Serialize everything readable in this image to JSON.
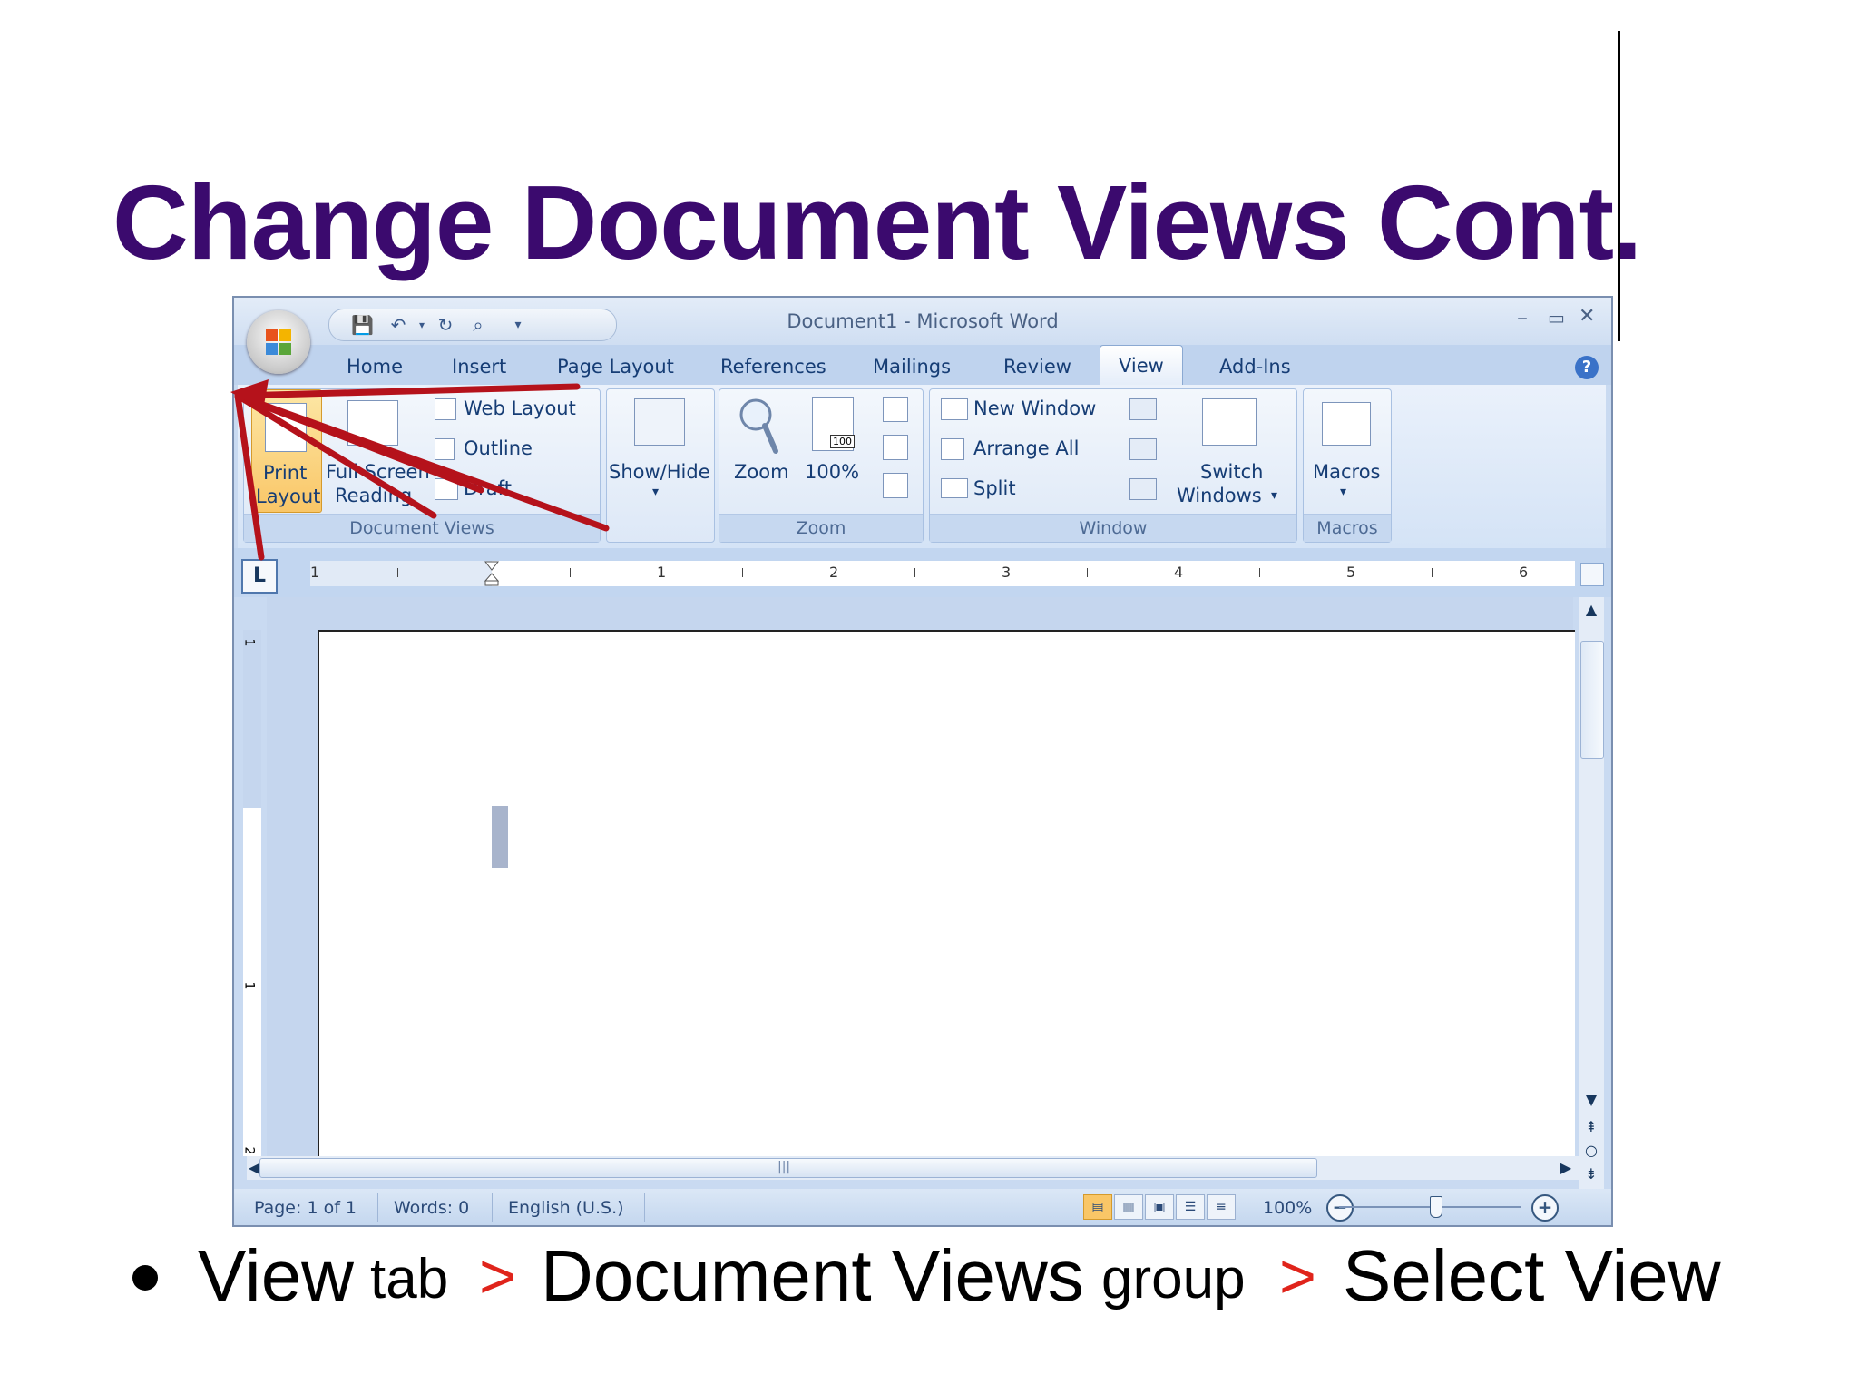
{
  "slide": {
    "title": "Change Document Views Cont.",
    "bullet": {
      "view": "View",
      "tab_word": "tab",
      "sep1": ">",
      "document_views": "Document Views",
      "group_word": "group",
      "sep2": ">",
      "select_view": "Select View"
    }
  },
  "word": {
    "window_title": "Document1 - Microsoft Word",
    "window_buttons": [
      "–",
      "▭",
      "✕"
    ],
    "tabs": [
      "Home",
      "Insert",
      "Page Layout",
      "References",
      "Mailings",
      "Review",
      "View",
      "Add-Ins"
    ],
    "active_tab": "View",
    "ribbon": {
      "document_views": {
        "label": "Document Views",
        "print_layout": [
          "Print",
          "Layout"
        ],
        "full_screen_reading": [
          "Full Screen",
          "Reading"
        ],
        "web_layout": "Web Layout",
        "outline": "Outline",
        "draft": "Draft"
      },
      "show_hide": {
        "label": "Show/Hide",
        "arrow": "▾"
      },
      "zoom": {
        "label": "Zoom",
        "zoom_button": "Zoom",
        "hundred_button": "100%",
        "hundred_icon_text": "100"
      },
      "window": {
        "label": "Window",
        "new_window": "New Window",
        "arrange_all": "Arrange All",
        "split": "Split",
        "switch_windows": [
          "Switch",
          "Windows"
        ],
        "dropdown": "▾"
      },
      "macros": {
        "label": "Macros",
        "button": "Macros",
        "arrow": "▾"
      }
    },
    "ruler": {
      "tab_selector": "L",
      "numbers": [
        "1",
        "1",
        "2",
        "3",
        "4",
        "5",
        "6"
      ],
      "vertical_numbers": [
        "1",
        "1",
        "2"
      ]
    },
    "status": {
      "page": "Page: 1 of 1",
      "words": "Words: 0",
      "language": "English (U.S.)",
      "zoom": "100%",
      "zoom_out": "−",
      "zoom_in": "+"
    },
    "scroll": {
      "up": "▲",
      "down": "▼",
      "prev": "⇞",
      "browse": "○",
      "next": "⇟",
      "left": "◀",
      "right": "▶",
      "grip": "|||"
    }
  },
  "colors": {
    "title": "#3b0a6e",
    "separator": "#e0241b",
    "annotation_arrows": "#b5121b",
    "ribbon": "#d4e3f6"
  },
  "icons": [
    "office-button-icon",
    "save-icon",
    "undo-icon",
    "redo-icon",
    "print-preview-icon",
    "help-icon"
  ]
}
